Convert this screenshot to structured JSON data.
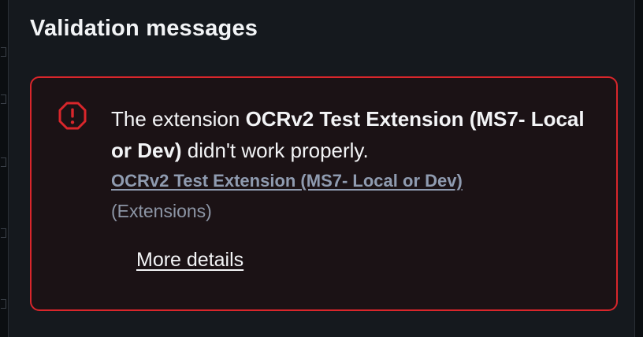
{
  "panel": {
    "title": "Validation messages"
  },
  "alert": {
    "severity_icon": "octagon-alert-icon",
    "message_prefix": "The extension ",
    "extension_name": "OCRv2 Test Extension (MS7- Local or Dev)",
    "message_suffix": " didn't work properly.",
    "link_text": "OCRv2 Test Extension (MS7- Local or Dev)",
    "category": "(Extensions)",
    "more_details_label": "More details"
  },
  "colors": {
    "error_red": "#d9262b",
    "alert_bg": "#1b1215",
    "panel_bg": "#15191e",
    "link": "#8f9bb0"
  }
}
